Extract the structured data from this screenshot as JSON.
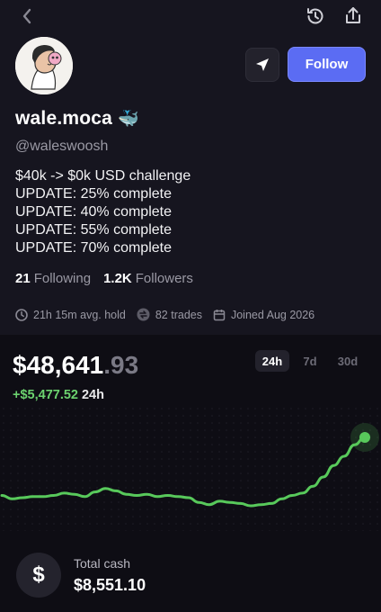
{
  "topbar": {
    "back_icon": "chevron-left-icon",
    "history_icon": "history-icon",
    "share_icon": "share-icon"
  },
  "profile": {
    "name": "wale.moca",
    "name_emoji": "🐳",
    "handle": "@waleswoosh",
    "bio": [
      "$40k -> $0k USD challenge",
      "UPDATE: 25% complete",
      "UPDATE: 40% complete",
      "UPDATE: 55% complete",
      "UPDATE: 70% complete"
    ],
    "following_count": "21",
    "following_label": "Following",
    "followers_count": "1.2K",
    "followers_label": "Followers",
    "follow_button": "Follow",
    "avg_hold": "21h 15m avg. hold",
    "trades": "82 trades",
    "joined": "Joined Aug 2026"
  },
  "portfolio": {
    "balance_main": "$48,641",
    "balance_cents": ".93",
    "change_amount": "+$5,477.52",
    "change_period": "24h",
    "ranges": [
      "24h",
      "7d",
      "30d"
    ],
    "active_range": "24h",
    "cash_symbol": "$",
    "cash_label": "Total cash",
    "cash_value": "$8,551.10"
  },
  "colors": {
    "accent": "#5b6cf3",
    "positive": "#6cd26f",
    "background": "#16151f"
  },
  "chart_data": {
    "type": "line",
    "series": [
      {
        "values": [
          43.6,
          43.3,
          43.4,
          43.5,
          43.5,
          43.6,
          43.8,
          43.7,
          43.5,
          43.9,
          44.2,
          44.0,
          43.7,
          43.6,
          43.7,
          43.5,
          43.6,
          43.5,
          43.4,
          43.0,
          42.8,
          43.1,
          43.0,
          42.9,
          42.7,
          42.8,
          42.9,
          43.3,
          43.6,
          43.8,
          44.4,
          45.2,
          46.2,
          47.0,
          48.0,
          48.64
        ]
      }
    ]
  }
}
